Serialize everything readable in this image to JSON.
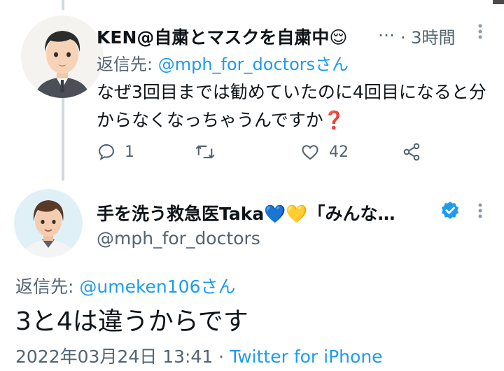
{
  "tweet1": {
    "display_name": "KEN@自粛とマスクを自粛中😌",
    "ellipsis": "…",
    "time": "· 3時間",
    "reply_label": "返信先: ",
    "reply_to": "@mph_for_doctorsさん",
    "text": "なぜ3回目までは勧めていたのに4回目になると分からなくなっちゃうんですか",
    "text_mark": "❓",
    "reply_count": "1",
    "retweet_count": "",
    "like_count": "42"
  },
  "tweet2": {
    "display_name": "手を洗う救急医Taka💙💛「みんな…",
    "handle": "@mph_for_doctors",
    "reply_label": "返信先: ",
    "reply_to": "@umeken106さん",
    "text": "3と4は違うからです",
    "timestamp": "2022年03月24日 13:41 · ",
    "client": "Twitter for iPhone"
  },
  "colors": {
    "link": "#1d9bf0",
    "secondary": "#536471",
    "verified": "#1d9bf0"
  }
}
